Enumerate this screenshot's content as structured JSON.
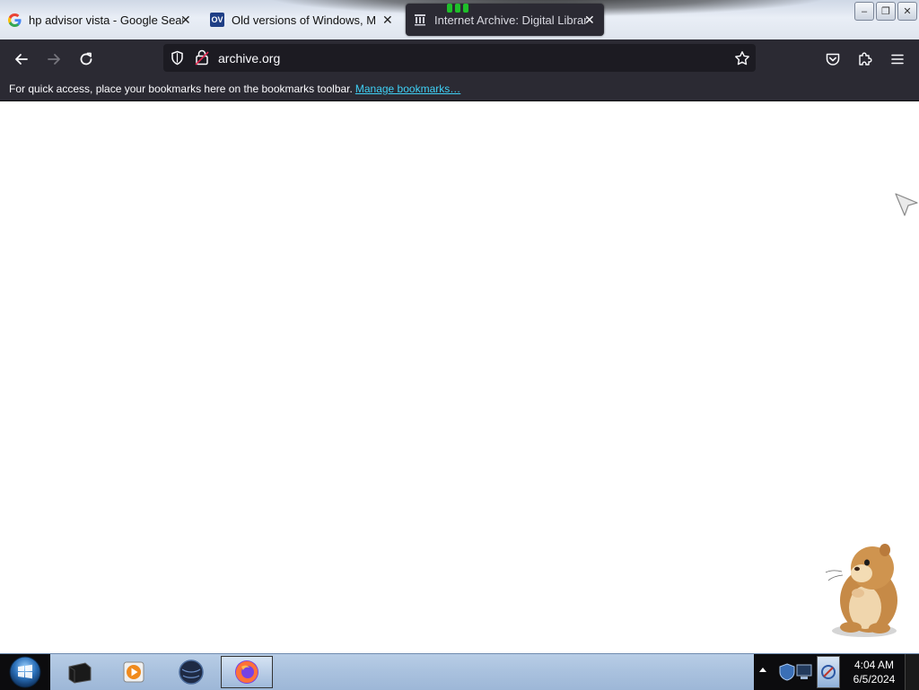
{
  "tabs": [
    {
      "title": "hp advisor vista - Google Search",
      "close": "✕"
    },
    {
      "title": "Old versions of Windows, Mac",
      "favicon_text": "OV",
      "close": "✕"
    },
    {
      "title": "Internet Archive: Digital Library",
      "close": "✕"
    }
  ],
  "window_controls": {
    "minimize": "–",
    "restore": "❐",
    "close": "✕"
  },
  "urlbar": {
    "url": "archive.org"
  },
  "bookmarks_bar": {
    "message": "For quick access, place your bookmarks here on the bookmarks toolbar.",
    "link": "Manage bookmarks…"
  },
  "taskbar": {
    "clock_time": "4:04 AM",
    "clock_date": "6/5/2024"
  },
  "colors": {
    "toolbar": "#2b2a33",
    "urlbar": "#1c1b22",
    "link": "#3fd0f5",
    "taskbar": "#a9c1de"
  }
}
